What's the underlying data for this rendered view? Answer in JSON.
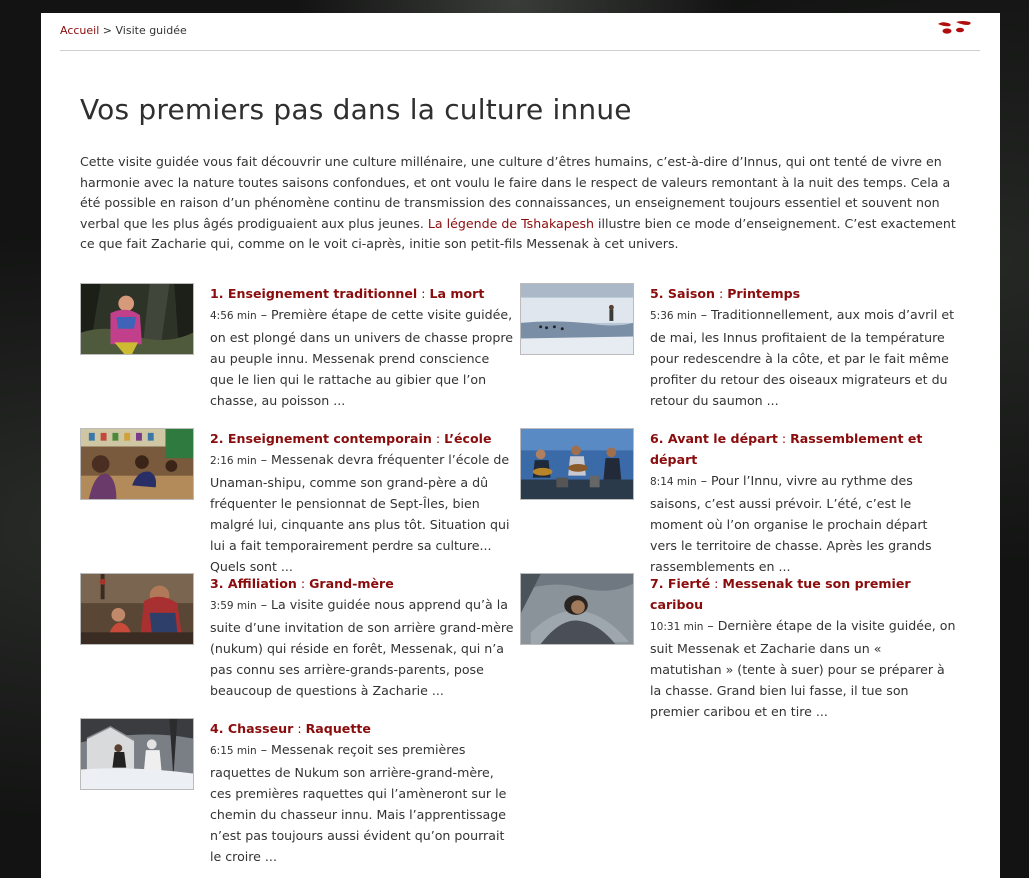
{
  "breadcrumb": {
    "home": "Accueil",
    "separator": ">",
    "current": "Visite guidée"
  },
  "page_title": "Vos premiers pas dans la culture innue",
  "intro": {
    "text_before_link": "Cette visite guidée vous fait découvrir une culture millénaire, une culture d’êtres humains, c’est-à-dire d’Innus, qui ont tenté de vivre en harmonie avec la nature toutes saisons confondues, et ont voulu le faire dans le respect de valeurs remontant à la nuit des temps. Cela a été possible en raison d’un phénomène continu de transmission des connaissances, un enseignement toujours essentiel et souvent non verbal que les plus âgés prodiguaient aux plus jeunes. ",
    "link": "La légende de Tshakapesh",
    "text_after_link": " illustre bien ce mode d’enseignement. C’est exactement ce que fait Zacharie qui, comme on le voit ci-après, initie son petit-fils Messenak à cet univers."
  },
  "items": [
    {
      "title_main": "1. Enseignement traditionnel",
      "title_sub": "La mort",
      "duration": "4:56 min",
      "desc": " – Première étape de cette visite guidée, on est plongé dans un univers de chasse propre au peuple innu. Messenak prend conscience que le lien qui le rattache au gibier que l’on chasse, au poisson ...",
      "thumb": "forest-child"
    },
    {
      "title_main": "2. Enseignement contemporain",
      "title_sub": "L’école",
      "duration": "2:16 min",
      "desc": " – Messenak devra fréquenter l’école de Unaman-shipu, comme son grand-père a dû fréquenter le pensionnat de Sept-Îles, bien malgré lui, cinquante ans plus tôt. Situation qui lui a fait temporairement perdre sa culture... Quels sont ...",
      "thumb": "classroom"
    },
    {
      "title_main": "3. Affiliation",
      "title_sub": "Grand-mère",
      "duration": "3:59 min",
      "desc": " – La visite guidée nous apprend qu’à la suite d’une invitation de son arrière grand-mère (nukum) qui réside en forêt, Messenak, qui n’a pas connu ses arrière-grands-parents, pose beaucoup de questions à Zacharie ...",
      "thumb": "grandmother"
    },
    {
      "title_main": "4. Chasseur",
      "title_sub": "Raquette",
      "duration": "6:15 min",
      "desc": " – Messenak reçoit ses premières raquettes de Nukum son arrière-grand-mère, ces premières raquettes qui l’amèneront sur le chemin du chasseur innu. Mais l’apprentissage n’est pas toujours aussi évident qu’on pourrait le croire ...",
      "thumb": "snow-camp"
    },
    {
      "title_main": "5. Saison",
      "title_sub": "Printemps",
      "duration": "5:36 min",
      "desc": " – Traditionnellement, aux mois d’avril et de mai, les Innus profitaient de la température pour redescendre à la côte, et par le fait même profiter du retour des oiseaux migrateurs et du retour du saumon ...",
      "thumb": "spring-coast"
    },
    {
      "title_main": "6. Avant le départ",
      "title_sub": "Rassemblement et départ",
      "duration": "8:14 min",
      "desc": " – Pour l’Innu, vivre au rythme des saisons, c’est aussi prévoir. L’été, c’est le moment où l’on organise le prochain départ vers le territoire de chasse. Après les grands rassemblements en ...",
      "thumb": "gathering"
    },
    {
      "title_main": "7. Fierté",
      "title_sub": "Messenak tue son premier caribou",
      "duration": "10:31 min",
      "desc": " – Dernière étape de la visite guidée, on suit Messenak et Zacharie dans un « matutishan » (tente à suer) pour se préparer à la chasse. Grand bien lui fasse, il tue son premier caribou et en tire ...",
      "thumb": "sweat-tent"
    }
  ],
  "colors": {
    "link": "#8a0c0c",
    "text": "#333333",
    "background": "#ffffff",
    "page_bg": "#121312"
  }
}
